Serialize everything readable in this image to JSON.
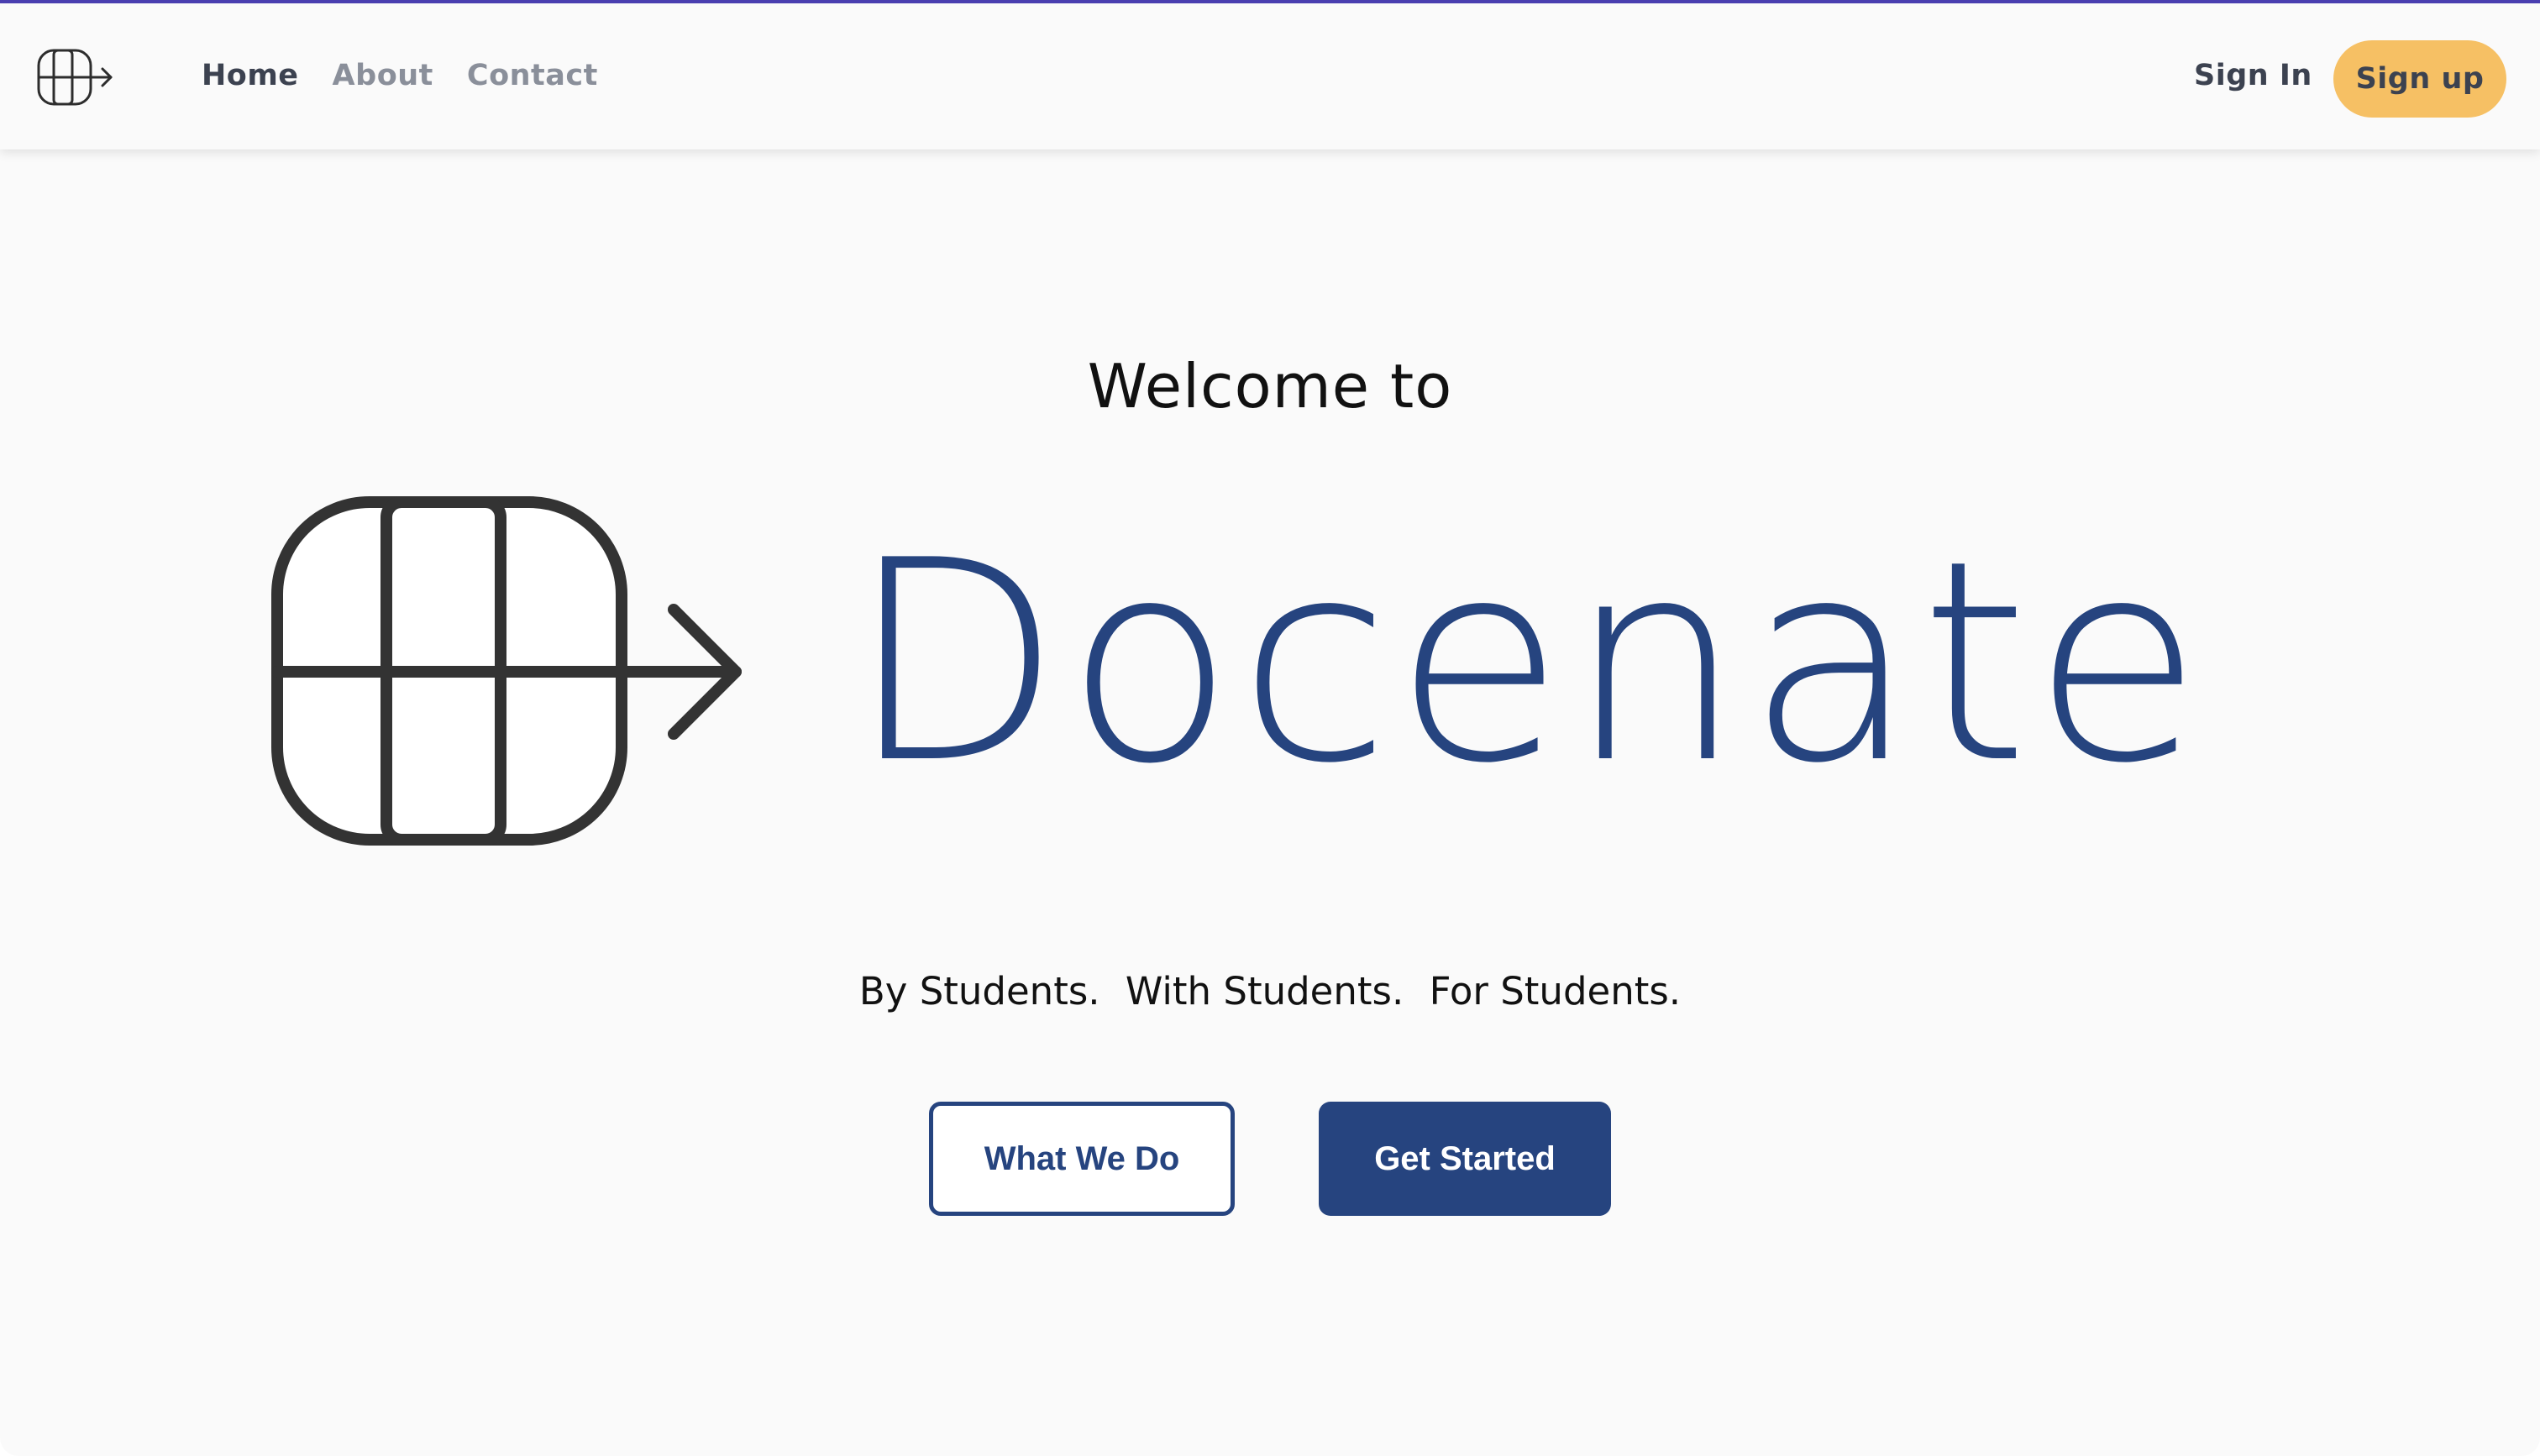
{
  "nav": {
    "logo_icon": "docenate-grid-arrow-logo",
    "links": [
      {
        "label": "Home",
        "active": true
      },
      {
        "label": "About",
        "active": false
      },
      {
        "label": "Contact",
        "active": false
      }
    ],
    "signin_label": "Sign In",
    "signup_label": "Sign up"
  },
  "hero": {
    "welcome": "Welcome to",
    "brand": "Docenate",
    "logo_icon": "docenate-grid-arrow-logo",
    "tagline": [
      "By Students.",
      "With Students.",
      "For Students."
    ],
    "primary_button": "Get Started",
    "secondary_button": "What We Do"
  },
  "colors": {
    "brand_blue": "#26447f",
    "signup_yellow": "#f6c064",
    "top_accent": "#4a3fb0",
    "text_dark": "#3c4250",
    "text_muted": "#8a8f9a"
  }
}
